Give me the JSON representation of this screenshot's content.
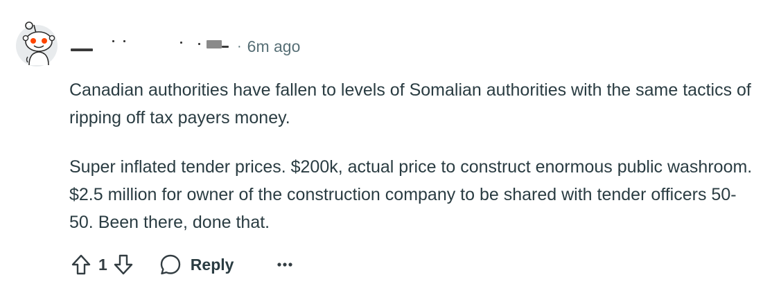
{
  "comment": {
    "author_redacted": true,
    "separator": "·",
    "timestamp": "6m ago",
    "paragraphs": [
      "Canadian authorities have fallen to levels of Somalian authorities with the same tactics of ripping off tax payers money.",
      "Super inflated tender prices. $200k, actual price to construct enormous public washroom. $2.5 million for owner of the construction company to be shared with tender officers 50-50. Been there, done that."
    ]
  },
  "actions": {
    "upvote_icon": "arrow-up-icon",
    "vote_count": "1",
    "downvote_icon": "arrow-down-icon",
    "reply_icon": "speech-bubble-icon",
    "reply_label": "Reply",
    "more_icon": "ellipsis-icon"
  },
  "avatar": {
    "icon": "reddit-snoo-avatar",
    "colors": {
      "background": "#e8ebed",
      "accent": "#ff4500"
    }
  }
}
